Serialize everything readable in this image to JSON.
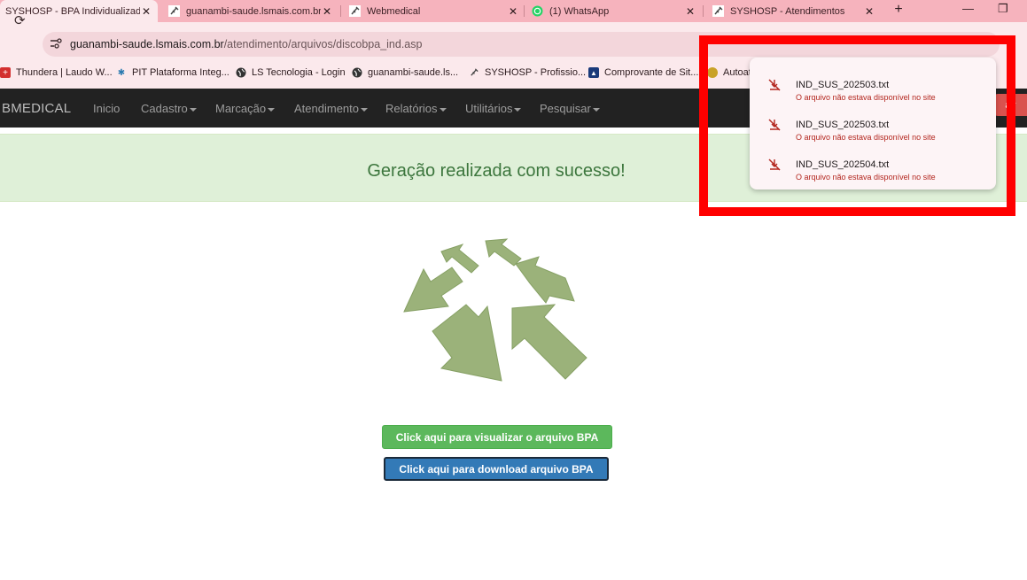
{
  "browser": {
    "tabs": [
      {
        "title": "SYSHOSP - BPA Individualizado",
        "icon": "syshosp-icon"
      },
      {
        "title": "guanambi-saude.lsmais.com.br",
        "icon": "syringe-icon"
      },
      {
        "title": "Webmedical",
        "icon": "syringe-icon"
      },
      {
        "title": "(1) WhatsApp",
        "icon": "whatsapp-icon"
      },
      {
        "title": "SYSHOSP - Atendimentos",
        "icon": "syringe-icon"
      }
    ],
    "new_tab": "+",
    "minimize": "—",
    "restore": "❐",
    "address": {
      "host": "guanambi-saude.lsmais.com.br",
      "path": "/atendimento/arquivos/discobpa_ind.asp"
    },
    "bookmarks": [
      {
        "label": "Thundera | Laudo W...",
        "icon": "thundera-icon",
        "color": "#d32f2f"
      },
      {
        "label": "PIT Plataforma Integ...",
        "icon": "pit-icon",
        "color": "#2a7ab0"
      },
      {
        "label": "LS Tecnologia - Login",
        "icon": "globe-icon",
        "color": "#333333"
      },
      {
        "label": "guanambi-saude.ls...",
        "icon": "globe-icon",
        "color": "#333333"
      },
      {
        "label": "SYSHOSP - Profissio...",
        "icon": "syringe-icon",
        "color": "#333333"
      },
      {
        "label": "Comprovante de Sit...",
        "icon": "gov-icon",
        "color": "#1a3a7a"
      },
      {
        "label": "Autoat",
        "icon": "autoat-icon",
        "color": "#c9a227"
      }
    ]
  },
  "app": {
    "brand": "BMEDICAL",
    "nav": [
      {
        "label": "Inicio",
        "dropdown": false
      },
      {
        "label": "Cadastro",
        "dropdown": true
      },
      {
        "label": "Marcação",
        "dropdown": true
      },
      {
        "label": "Atendimento",
        "dropdown": true
      },
      {
        "label": "Relatórios",
        "dropdown": true
      },
      {
        "label": "Utilitários",
        "dropdown": true
      },
      {
        "label": "Pesquisar",
        "dropdown": true
      }
    ],
    "logout_label": "air",
    "alert_message": "Geração realizada com sucesso!",
    "view_button": "Click aqui para visualizar o arquivo BPA",
    "download_button": "Click aqui para download arquivo BPA"
  },
  "downloads": [
    {
      "filename": "IND_SUS_202503.txt",
      "status": "O arquivo não estava disponível no site"
    },
    {
      "filename": "IND_SUS_202503.txt",
      "status": "O arquivo não estava disponível no site"
    },
    {
      "filename": "IND_SUS_202504.txt",
      "status": "O arquivo não estava disponível no site"
    }
  ],
  "colors": {
    "tabstrip": "#f6b3bd",
    "toolbar": "#fbe9ec",
    "navbar": "#222222",
    "alert_bg": "#dff0d8",
    "alert_text": "#3c763d",
    "btn_green": "#5cb85c",
    "btn_blue": "#337ab7",
    "graphic_green": "#9bb27a",
    "highlight": "#ff0000",
    "error_text": "#b3261e"
  }
}
